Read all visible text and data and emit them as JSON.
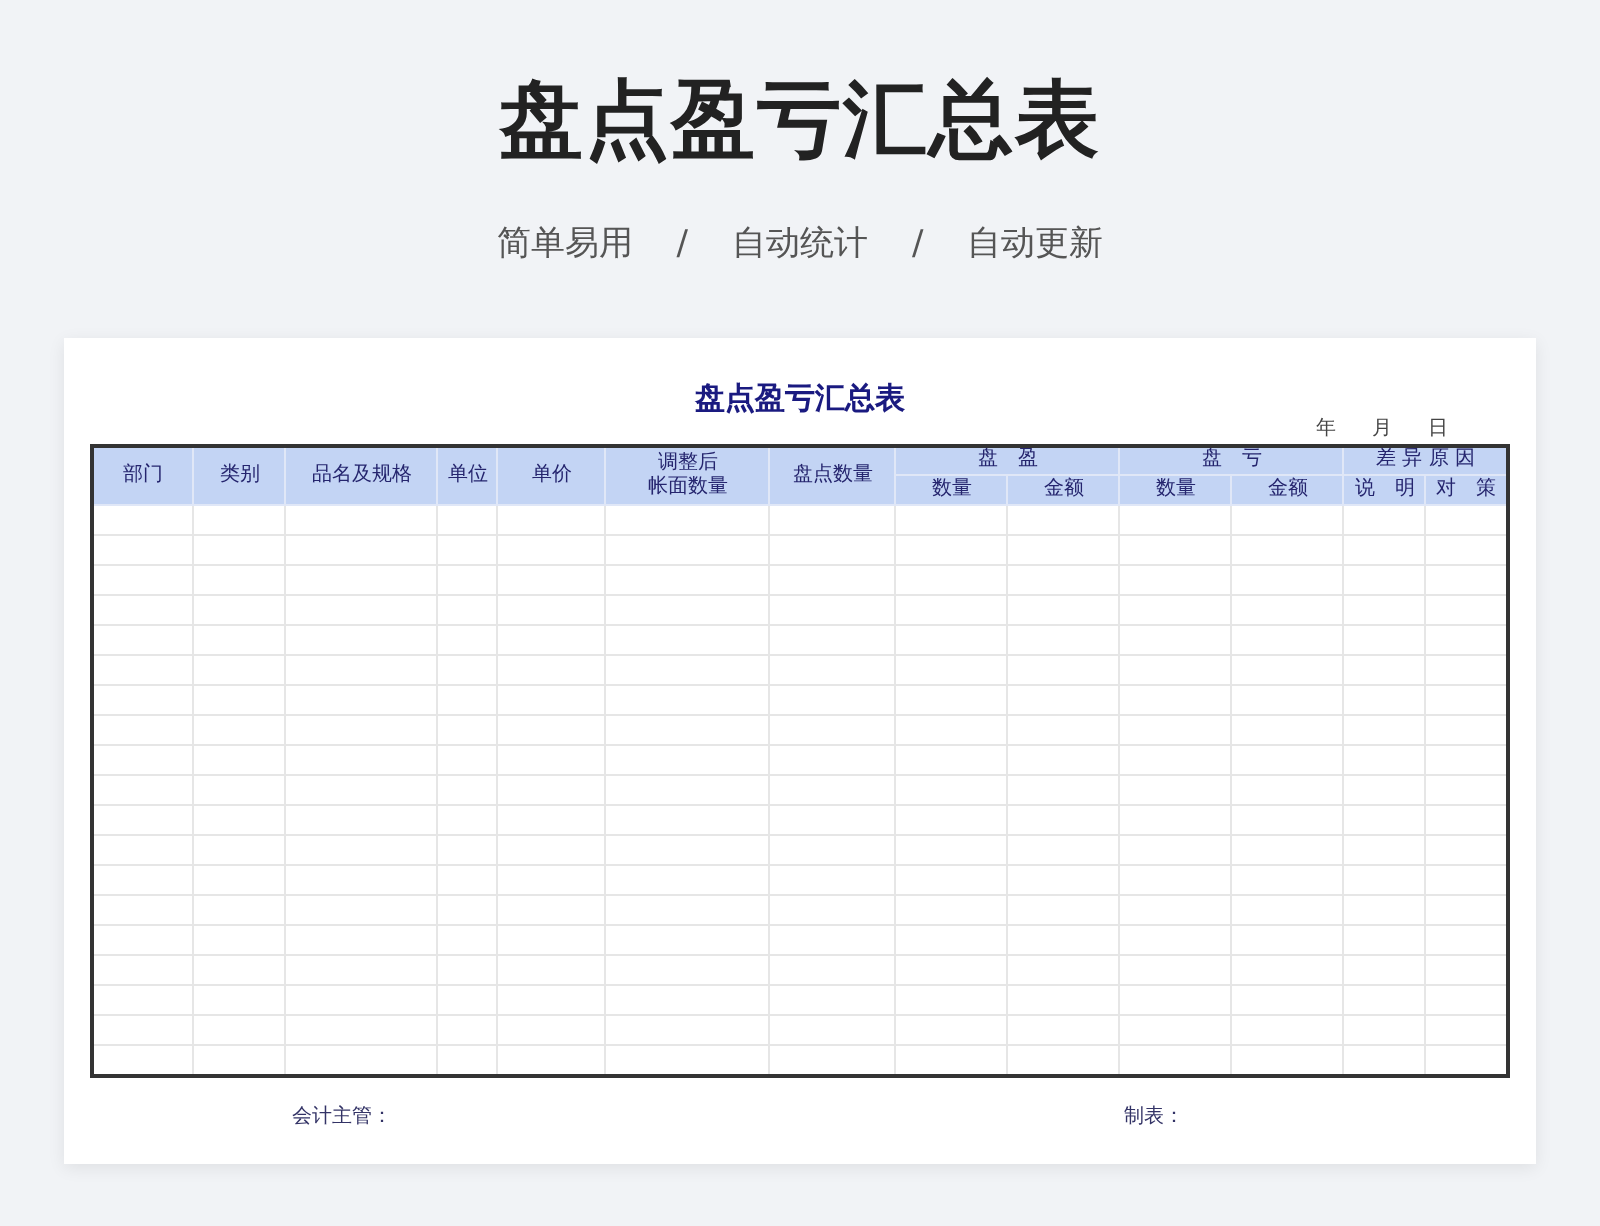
{
  "page_title": "盘点盈亏汇总表",
  "taglines": [
    "简单易用",
    "/",
    "自动统计",
    "/",
    "自动更新"
  ],
  "sheet": {
    "title": "盘点盈亏汇总表",
    "date_parts": [
      "年",
      "月",
      "日"
    ],
    "columns": [
      {
        "label": "部门"
      },
      {
        "label": "类别"
      },
      {
        "label": "品名及规格"
      },
      {
        "label": "单位"
      },
      {
        "label": "单价"
      },
      {
        "lines": [
          "调整后",
          "帐面数量"
        ]
      },
      {
        "label": "盘点数量"
      },
      {
        "label": "盘　盈",
        "children": [
          "数量",
          "金额"
        ]
      },
      {
        "label": "盘　亏",
        "children": [
          "数量",
          "金额"
        ]
      },
      {
        "label": "差 异 原 因",
        "children": [
          "说　明",
          "对　策"
        ]
      }
    ],
    "signatures": [
      "会计主管：",
      "制表："
    ]
  }
}
